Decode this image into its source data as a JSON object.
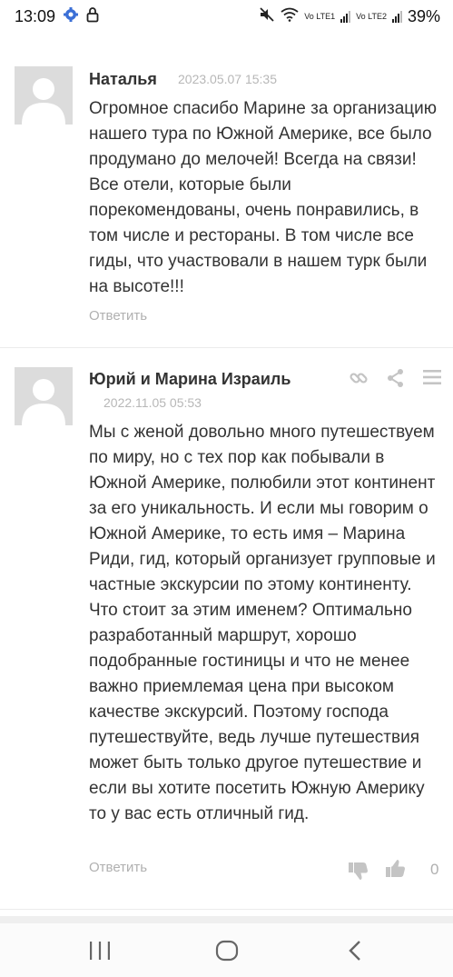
{
  "status_bar": {
    "time": "13:09",
    "left_icons": [
      "settings-gear-icon",
      "lock-icon"
    ],
    "right_icons": [
      "mute-icon",
      "wifi-icon",
      "lte1-signal-icon",
      "lte2-signal-icon"
    ],
    "lte1_label": "Vo LTE1",
    "lte2_label": "Vo LTE2",
    "battery": "39%"
  },
  "comments": [
    {
      "author": "Наталья",
      "date": "2023.05.07 15:35",
      "text": "Огромное спасибо Марине за организацию нашего тура по Южной Америке, все было продумано до мелочей! Всегда на связи! Все отели, которые были порекомендованы, очень понравились, в том числе и рестораны. В том числе все гиды, что участвовали в нашем турк были на высоте!!!",
      "reply_label": "Ответить"
    },
    {
      "author": "Юрий и Марина Израиль",
      "date": "2022.11.05 05:53",
      "text": "Мы с женой довольно много путешествуем по миру, но с тех пор как побывали в Южной Америке, полюбили этот континент за его уникальность. И если мы говорим о Южной Америке, то есть имя – Марина Риди, гид, который организует групповые и частные экскурсии по этому континенту. Что стоит за этим именем? Оптимально разработанный маршрут, хорошо подобранные гостиницы и что не менее важно приемлемая цена при высоком качестве экскурсий. Поэтому господа путешествуйте, ведь лучше путешествия может быть только другое путешествие и если вы хотите посетить Южную Америку то у вас есть отличный гид.",
      "reply_label": "Ответить",
      "header_icons": [
        "link-icon",
        "share-icon",
        "menu-icon"
      ],
      "vote_icons": [
        "thumbs-down-icon",
        "thumbs-up-icon"
      ],
      "rating": "0"
    }
  ],
  "nav_bar": {
    "icons": [
      "recent-apps-icon",
      "home-icon",
      "back-icon"
    ]
  },
  "colors": {
    "text": "#333333",
    "muted": "#b0b0b0",
    "avatar_bg": "#dcdcdc",
    "icon_gray": "#c4c4c4"
  }
}
